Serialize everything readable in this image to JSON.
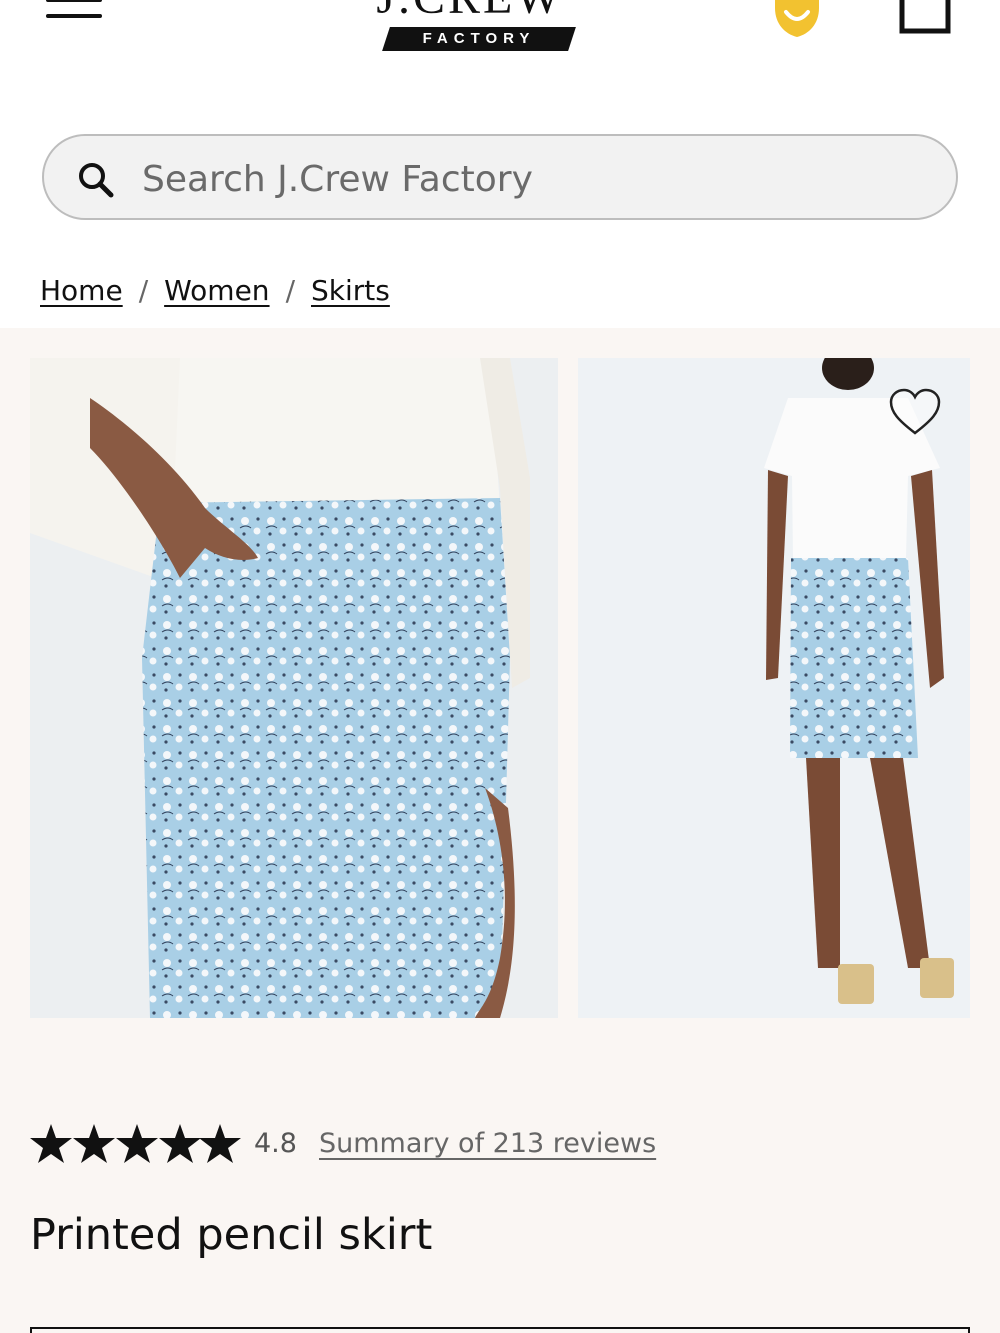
{
  "header": {
    "logo_wordmark": "J.CREW",
    "logo_sub": "FACTORY",
    "menu_icon": "hamburger-menu-icon",
    "rewards_icon": "rewards-smile-icon",
    "bag_icon": "shopping-bag-icon"
  },
  "search": {
    "placeholder": "Search J.Crew Factory",
    "icon": "search-icon"
  },
  "breadcrumb": {
    "items": [
      "Home",
      "Women",
      "Skirts"
    ],
    "separator": "/"
  },
  "gallery": {
    "images": [
      "product-photo-front-closeup",
      "product-photo-back-full"
    ],
    "favorite_icon": "heart-icon"
  },
  "product": {
    "rating_value": "4.8",
    "rating_stars": 5,
    "reviews_link": "Summary of 213 reviews",
    "title": "Printed pencil skirt"
  },
  "colors": {
    "accent_yellow": "#f2c230",
    "skirt_blue": "#a9cfe6",
    "gallery_bg": "#faf6f3"
  }
}
